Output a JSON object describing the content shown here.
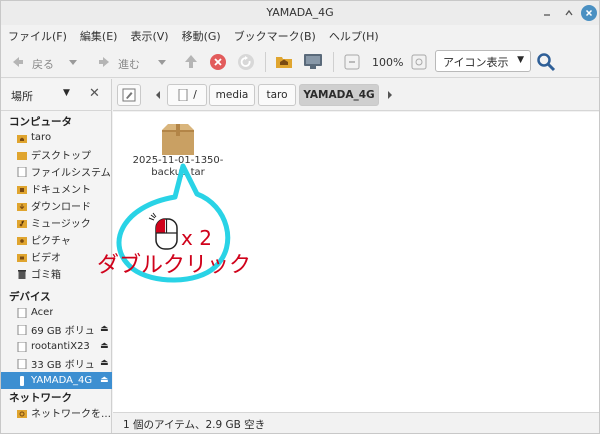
{
  "window": {
    "title": "YAMADA_4G"
  },
  "menubar": [
    "ファイル(F)",
    "編集(E)",
    "表示(V)",
    "移動(G)",
    "ブックマーク(B)",
    "ヘルプ(H)"
  ],
  "toolbar": {
    "back_label": "戻る",
    "forward_label": "進む",
    "zoom": "100%",
    "view_mode": "アイコン表示"
  },
  "sidebar": {
    "header": "場所",
    "sections": {
      "computer": "コンピュータ",
      "devices": "デバイス",
      "network": "ネットワーク"
    },
    "computer_items": [
      {
        "label": "taro",
        "icon": "home-folder-icon"
      },
      {
        "label": "デスクトップ",
        "icon": "desktop-folder-icon"
      },
      {
        "label": "ファイルシステム",
        "icon": "drive-icon"
      },
      {
        "label": "ドキュメント",
        "icon": "documents-folder-icon"
      },
      {
        "label": "ダウンロード",
        "icon": "downloads-folder-icon"
      },
      {
        "label": "ミュージック",
        "icon": "music-folder-icon"
      },
      {
        "label": "ピクチャ",
        "icon": "pictures-folder-icon"
      },
      {
        "label": "ビデオ",
        "icon": "videos-folder-icon"
      },
      {
        "label": "ゴミ箱",
        "icon": "trash-icon"
      }
    ],
    "device_items": [
      {
        "label": "Acer",
        "icon": "drive-icon"
      },
      {
        "label": "69 GB ボリュ…",
        "icon": "drive-icon"
      },
      {
        "label": "rootantiX23",
        "icon": "drive-icon"
      },
      {
        "label": "33 GB ボリュ…",
        "icon": "drive-icon"
      },
      {
        "label": "YAMADA_4G",
        "icon": "usb-drive-icon"
      }
    ],
    "network_items": [
      {
        "label": "ネットワークを…",
        "icon": "network-icon"
      }
    ]
  },
  "pathbar": {
    "crumbs": [
      "/",
      "media",
      "taro",
      "YAMADA_4G"
    ]
  },
  "content": {
    "file": {
      "name_line1": "2025-11-01-1350-",
      "name_line2": "backup.tar",
      "icon": "archive-package-icon"
    }
  },
  "annotation": {
    "times": "x 2",
    "caption": "ダブルクリック",
    "color": "#d0021b",
    "bubble_color": "#29d3e6"
  },
  "status": "1 個のアイテム、2.9 GB 空き"
}
